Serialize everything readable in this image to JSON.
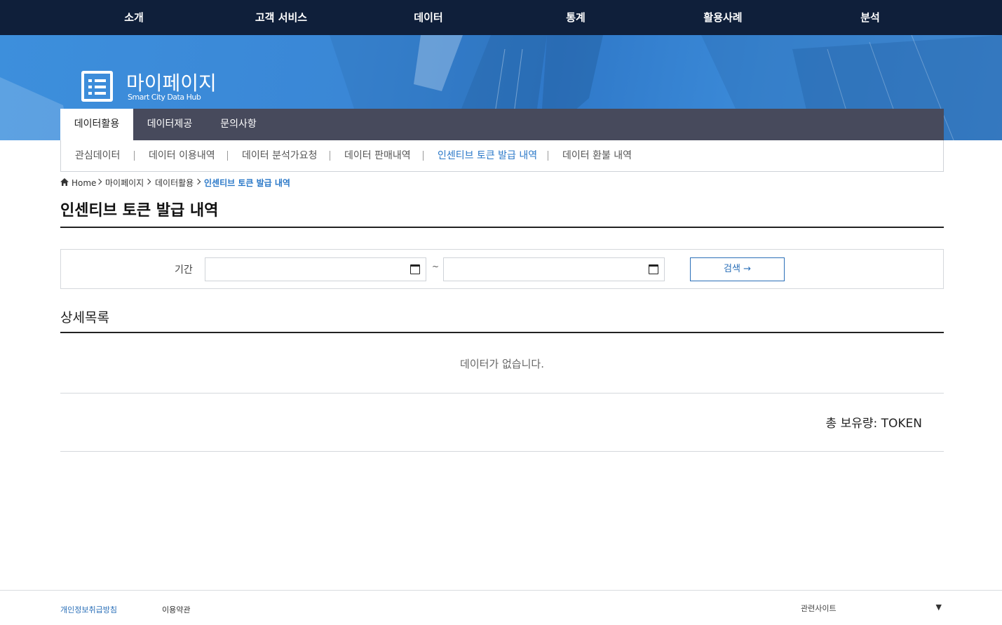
{
  "topnav": {
    "items": [
      "소개",
      "고객 서비스",
      "데이터",
      "통계",
      "활용사례",
      "분석"
    ]
  },
  "banner": {
    "title": "마이페이지",
    "subtitle": "Smart City Data Hub"
  },
  "tabs": {
    "items": [
      "데이터활용",
      "데이터제공",
      "문의사항"
    ],
    "active": "데이터활용"
  },
  "subnav": {
    "items": [
      "관심데이터",
      "데이터 이용내역",
      "데이터 분석가요청",
      "데이터 판매내역",
      "인센티브 토큰 발급 내역",
      "데이터 환불 내역"
    ],
    "active": "인센티브 토큰 발급 내역"
  },
  "breadcrumb": {
    "home": "Home",
    "items": [
      "마이페이지",
      "데이터활용",
      "인센티브 토큰 발급 내역"
    ]
  },
  "page": {
    "title": "인센티브 토큰 발급 내역"
  },
  "search": {
    "period_label": "기간",
    "start_date": "",
    "end_date": "",
    "separator": "~",
    "button_label": "검색 →"
  },
  "list": {
    "title": "상세목록",
    "empty_message": "데이터가 없습니다.",
    "total_label": "총 보유량: TOKEN"
  },
  "footer": {
    "privacy_label": "개인정보취급방침",
    "terms_label": "이용약관",
    "related_sites_label": "관련사이트",
    "related_sites_arrow": "▼"
  },
  "colors": {
    "topnav_bg": "#0f1f3a",
    "tab_bar_bg": "#474a5c",
    "accent": "#2a78c8",
    "button_border": "#2a6fb8"
  },
  "icons": {
    "banner": "list-document-icon",
    "breadcrumb_home": "home-icon",
    "date_picker": "calendar-icon"
  }
}
